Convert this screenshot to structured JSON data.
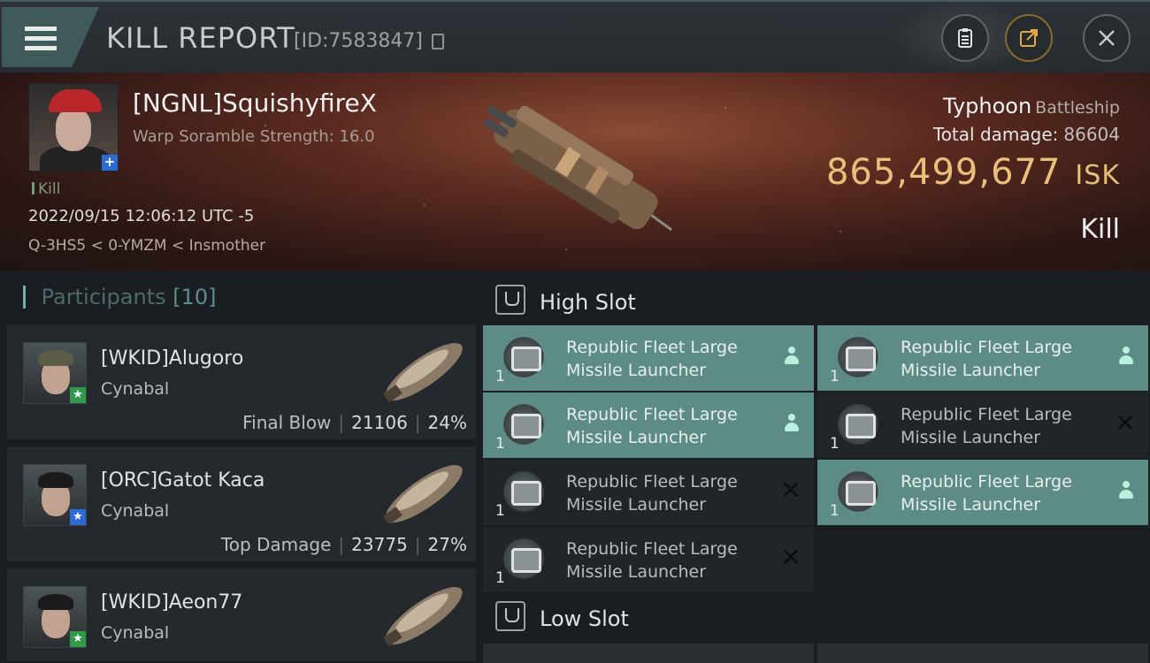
{
  "header": {
    "title": "KILL REPORT",
    "report_id": "[ID:7583847]"
  },
  "victim": {
    "name": "[NGNL]SquishyfireX",
    "scramble": "Warp Soramble Strength: 16.0",
    "tag": "Kill",
    "datetime": "2022/09/15 12:06:12 UTC -5",
    "location": "Q-3HS5 < 0-YMZM < Insmother",
    "ship": "Typhoon",
    "ship_class": "Battleship",
    "total_damage_label": "Total damage:",
    "total_damage": "86604",
    "isk_value": "865,499,677",
    "isk_unit": "ISK",
    "outcome": "Kill"
  },
  "participants": {
    "label": "Participants",
    "count": "[10]",
    "rows": [
      {
        "name": "[WKID]Alugoro",
        "corp": "Cynabal",
        "stat_label": "Final Blow",
        "damage": "21106",
        "percent": "24%",
        "badge_color": "#2e9a4a"
      },
      {
        "name": "[ORC]Gatot Kaca",
        "corp": "Cynabal",
        "stat_label": "Top Damage",
        "damage": "23775",
        "percent": "27%",
        "badge_color": "#2c6bd6"
      },
      {
        "name": "[WKID]Aeon77",
        "corp": "Cynabal",
        "badge_color": "#2e9a4a"
      }
    ]
  },
  "high_slot": {
    "label": "High Slot",
    "modules": [
      {
        "line1": "Republic Fleet Large",
        "line2": "Missile Launcher",
        "qty": "1",
        "state": "fitted"
      },
      {
        "line1": "Republic Fleet Large",
        "line2": "Missile Launcher",
        "qty": "1",
        "state": "fitted"
      },
      {
        "line1": "Republic Fleet Large",
        "line2": "Missile Launcher",
        "qty": "1",
        "state": "fitted"
      },
      {
        "line1": "Republic Fleet Large",
        "line2": "Missile Launcher",
        "qty": "1",
        "state": "destroyed",
        "mark": "✕"
      },
      {
        "line1": "Republic Fleet Large",
        "line2": "Missile Launcher",
        "qty": "1",
        "state": "destroyed",
        "mark": "✕"
      },
      {
        "line1": "Republic Fleet Large",
        "line2": "Missile Launcher",
        "qty": "1",
        "state": "fitted"
      },
      {
        "line1": "Republic Fleet Large",
        "line2": "Missile Launcher",
        "qty": "1",
        "state": "destroyed",
        "mark": "✕"
      }
    ]
  },
  "low_slot": {
    "label": "Low Slot"
  },
  "icons": {
    "menu": "menu-icon",
    "copy": "copy-icon",
    "clipboard": "clipboard-icon",
    "share": "share-icon",
    "close": "close-icon"
  }
}
